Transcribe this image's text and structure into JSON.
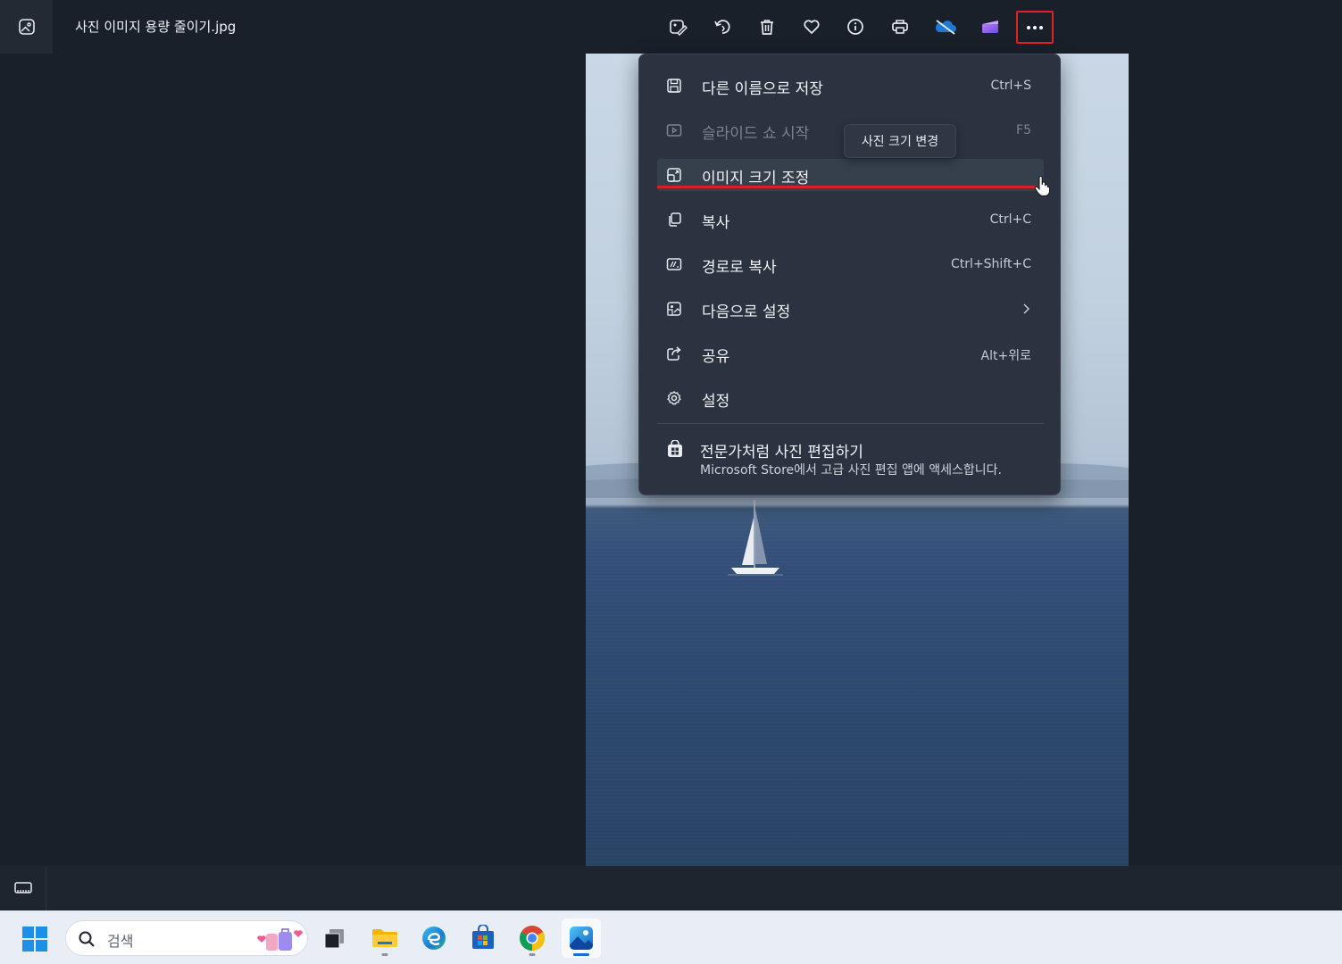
{
  "window": {
    "filename": "사진 이미지 용량 줄이기.jpg",
    "app_icon": "photos-app-icon"
  },
  "toolbar": {
    "buttons": [
      {
        "name": "edit-image-button",
        "icon": "edit-image-icon"
      },
      {
        "name": "rotate-button",
        "icon": "rotate-icon"
      },
      {
        "name": "delete-button",
        "icon": "trash-icon"
      },
      {
        "name": "favorite-button",
        "icon": "heart-icon"
      },
      {
        "name": "file-info-button",
        "icon": "info-icon"
      },
      {
        "name": "print-button",
        "icon": "printer-icon"
      },
      {
        "name": "onedrive-button",
        "icon": "onedrive-cloud-icon"
      },
      {
        "name": "clipchamp-button",
        "icon": "clipchamp-icon"
      },
      {
        "name": "more-options-button",
        "icon": "ellipsis-icon"
      }
    ]
  },
  "menu": {
    "items": [
      {
        "label": "다른 이름으로 저장",
        "shortcut": "Ctrl+S",
        "icon": "save-icon",
        "disabled": false
      },
      {
        "label": "슬라이드 쇼 시작",
        "shortcut": "F5",
        "icon": "slideshow-icon",
        "disabled": true
      },
      {
        "label": "이미지 크기 조정",
        "shortcut": "",
        "icon": "resize-image-icon",
        "disabled": false,
        "hovered": true
      },
      {
        "label": "복사",
        "shortcut": "Ctrl+C",
        "icon": "copy-icon",
        "disabled": false
      },
      {
        "label": "경로로 복사",
        "shortcut": "Ctrl+Shift+C",
        "icon": "copy-path-icon",
        "disabled": false
      },
      {
        "label": "다음으로 설정",
        "shortcut": "",
        "icon": "set-as-icon",
        "disabled": false,
        "submenu": true
      },
      {
        "label": "공유",
        "shortcut": "Alt+위로",
        "icon": "share-icon",
        "disabled": false
      },
      {
        "label": "설정",
        "shortcut": "",
        "icon": "settings-gear-icon",
        "disabled": false
      }
    ],
    "promo": {
      "title": "전문가처럼 사진 편집하기",
      "description": "Microsoft Store에서 고급 사진 편집 앱에 액세스합니다."
    }
  },
  "tooltip": {
    "text": "사진 크기 변경"
  },
  "taskbar": {
    "search_placeholder": "검색",
    "apps": [
      "task-view",
      "file-explorer",
      "edge",
      "microsoft-store",
      "chrome",
      "photos"
    ],
    "accent": "#1a6fd6"
  },
  "colors": {
    "highlight_red": "#d8202c",
    "menu_bg": "#2b3340",
    "app_bg": "#1a202a"
  }
}
